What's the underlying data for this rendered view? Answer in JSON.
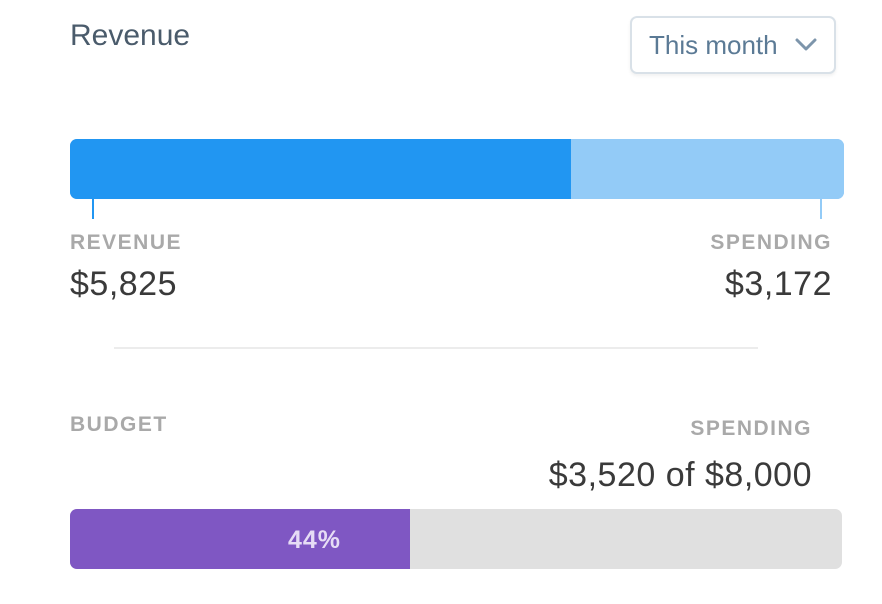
{
  "card": {
    "title": "Revenue"
  },
  "period_select": {
    "value": "This month",
    "icon": "chevron-down-icon"
  },
  "revenue_split": {
    "revenue_label": "REVENUE",
    "revenue_amount": "$5,825",
    "revenue_value": 5825,
    "spending_label": "SPENDING",
    "spending_amount": "$3,172",
    "spending_value": 3172,
    "colors": {
      "revenue": "#2196f2",
      "spending": "#93cbf7"
    }
  },
  "budget": {
    "label": "BUDGET",
    "spending_label": "SPENDING",
    "summary": "$3,520 of $8,000",
    "spent_value": 3520,
    "total_value": 8000,
    "percent_label": "44%",
    "percent": 44,
    "colors": {
      "fill": "#7f57c3",
      "track": "#e0e0e0"
    }
  }
}
